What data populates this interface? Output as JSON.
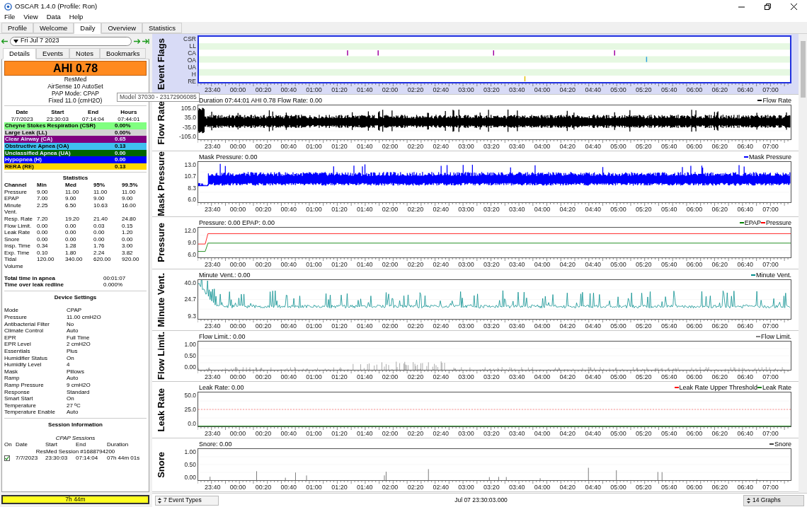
{
  "window": {
    "title": "OSCAR 1.4.0 (Profile: Ron)"
  },
  "menu": [
    "File",
    "View",
    "Data",
    "Help"
  ],
  "tabs": [
    {
      "label": "Profile",
      "selected": false
    },
    {
      "label": "Welcome",
      "selected": false
    },
    {
      "label": "Daily",
      "selected": true
    },
    {
      "label": "Overview",
      "selected": false
    },
    {
      "label": "Statistics",
      "selected": false
    }
  ],
  "date_nav": {
    "date": "Fri Jul 7 2023"
  },
  "detail_tabs": [
    {
      "label": "Details",
      "selected": true
    },
    {
      "label": "Events",
      "selected": false
    },
    {
      "label": "Notes",
      "selected": false
    },
    {
      "label": "Bookmarks",
      "selected": false
    }
  ],
  "summary": {
    "ahi": "AHI 0.78",
    "lines": [
      "ResMed",
      "AirSense 10 AutoSet",
      "PAP Mode: CPAP",
      "Fixed 11.0 (cmH2O)"
    ]
  },
  "tooltip": "Model 37030 - 23172906085",
  "session_table": {
    "columns": [
      "Date",
      "Start",
      "End",
      "Hours"
    ],
    "values": [
      "7/7/2023",
      "23:30:03",
      "07:14:04",
      "07:44:01"
    ]
  },
  "events": [
    {
      "name": "Cheyne Stokes Respiration (CSR)",
      "value": "0.00%",
      "color": "#80ff80"
    },
    {
      "name": "Large Leak (LL)",
      "value": "0.00%",
      "color": "#d3d3d3"
    },
    {
      "name": "Clear Airway (CA)",
      "value": "0.65",
      "color": "#800080"
    },
    {
      "name": "Obstructive Apnea (OA)",
      "value": "0.13",
      "color": "#40c0f0"
    },
    {
      "name": "Unclassified Apnea (UA)",
      "value": "0.00",
      "color": "#006400"
    },
    {
      "name": "Hypopnea (H)",
      "value": "0.00",
      "color": "#0000ff"
    },
    {
      "name": "RERA (RE)",
      "value": "0.13",
      "color": "#ffd700"
    }
  ],
  "statistics": {
    "title": "Statistics",
    "columns": [
      "Channel",
      "Min",
      "Med",
      "95%",
      "99.5%"
    ],
    "rows": [
      [
        "Pressure",
        "9.00",
        "11.00",
        "11.00",
        "11.00"
      ],
      [
        "EPAP",
        "7.00",
        "9.00",
        "9.00",
        "9.00"
      ],
      [
        "Minute Vent.",
        "2.25",
        "6.50",
        "10.63",
        "16.00"
      ],
      [
        "Resp. Rate",
        "7.20",
        "19.20",
        "21.40",
        "24.80"
      ],
      [
        "Flow Limit.",
        "0.00",
        "0.00",
        "0.03",
        "0.15"
      ],
      [
        "Leak Rate",
        "0.00",
        "0.00",
        "0.00",
        "1.20"
      ],
      [
        "Snore",
        "0.00",
        "0.00",
        "0.00",
        "0.00"
      ],
      [
        "Insp. Time",
        "0.34",
        "1.28",
        "1.76",
        "3.00"
      ],
      [
        "Exp. Time",
        "0.10",
        "1.80",
        "2.24",
        "3.82"
      ],
      [
        "Tidal Volume",
        "120.00",
        "340.00",
        "620.00",
        "920.00"
      ]
    ]
  },
  "totals": [
    {
      "label": "Total time in apnea",
      "value": "00:01:07"
    },
    {
      "label": "Time over leak redline",
      "value": "0.000%"
    }
  ],
  "device_settings": {
    "title": "Device Settings",
    "rows": [
      [
        "Mode",
        "CPAP"
      ],
      [
        "Pressure",
        "11.00 cmH2O"
      ],
      [
        "Antibacterial Filter",
        "No"
      ],
      [
        "Climate Control",
        "Auto"
      ],
      [
        "EPR",
        "Full Time"
      ],
      [
        "EPR Level",
        "2 cmH2O"
      ],
      [
        "Essentials",
        "Plus"
      ],
      [
        "Humidifier Status",
        "On"
      ],
      [
        "Humidity Level",
        "4"
      ],
      [
        "Mask",
        "Pillows"
      ],
      [
        "Ramp",
        "Auto"
      ],
      [
        "Ramp Pressure",
        "9 cmH2O"
      ],
      [
        "Response",
        "Standard"
      ],
      [
        "Smart Start",
        "On"
      ],
      [
        "Temperature",
        "27 ºC"
      ],
      [
        "Temperature Enable",
        "Auto"
      ]
    ]
  },
  "session_info": {
    "title": "Session Information",
    "subtitle": "CPAP Sessions",
    "columns": [
      "On",
      "Date",
      "Start",
      "End",
      "Duration"
    ],
    "group": "ResMed Session #1688794200",
    "rows": [
      {
        "checked": true,
        "date": "7/7/2023",
        "start": "23:30:03",
        "end": "07:14:04",
        "duration": "07h 44m 01s"
      }
    ]
  },
  "usage_bar": "7h 44m",
  "graphs": [
    {
      "kind": "flags",
      "title": "Event Flags",
      "rows": [
        "CSR",
        "LL",
        "CA",
        "OA",
        "UA",
        "H",
        "RE"
      ],
      "x_ticks": [
        "23:40",
        "00:00",
        "00:20",
        "00:40",
        "01:00",
        "01:20",
        "01:40",
        "02:00",
        "02:20",
        "02:40",
        "03:00",
        "03:20",
        "03:40",
        "04:00",
        "04:20",
        "04:40",
        "05:00",
        "05:20",
        "05:40",
        "06:00",
        "06:20",
        "06:40",
        "07:00"
      ]
    },
    {
      "kind": "noise",
      "title": "Flow Rate",
      "header": "Duration 07:44:01 AHI 0.78 Flow Rate: 0.00",
      "legend": [
        {
          "label": "Flow Rate",
          "color": "#000000"
        }
      ],
      "y_ticks": [
        "105.0",
        "35.0",
        "-35.0",
        "-105.0"
      ],
      "x_ticks": [
        "23:40",
        "00:00",
        "00:20",
        "00:40",
        "01:00",
        "01:20",
        "01:40",
        "02:00",
        "02:20",
        "02:40",
        "03:00",
        "03:20",
        "03:40",
        "04:00",
        "04:20",
        "04:40",
        "05:00",
        "05:20",
        "05:40",
        "06:00",
        "06:20",
        "06:40",
        "07:00"
      ]
    },
    {
      "kind": "band",
      "title": "Mask Pressure",
      "header": "Mask Pressure: 0.00",
      "legend": [
        {
          "label": "Mask Pressure",
          "color": "#0000ff"
        }
      ],
      "y_ticks": [
        "13.0",
        "10.7",
        "8.3",
        "6.0"
      ],
      "x_ticks": [
        "23:40",
        "00:00",
        "00:20",
        "00:40",
        "01:00",
        "01:20",
        "01:40",
        "02:00",
        "02:20",
        "02:40",
        "03:00",
        "03:20",
        "03:40",
        "04:00",
        "04:20",
        "04:40",
        "05:00",
        "05:20",
        "05:40",
        "06:00",
        "06:20",
        "06:40",
        "07:00"
      ]
    },
    {
      "kind": "steps",
      "title": "Pressure",
      "header": "Pressure: 0.00 EPAP: 0.00",
      "legend": [
        {
          "label": "EPAP",
          "color": "#008000"
        },
        {
          "label": "Pressure",
          "color": "#ff0000"
        }
      ],
      "y_ticks": [
        "12.0",
        "9.0",
        "6.0"
      ],
      "x_ticks": [
        "23:40",
        "00:00",
        "00:20",
        "00:40",
        "01:00",
        "01:20",
        "01:40",
        "02:00",
        "02:20",
        "02:40",
        "03:00",
        "03:20",
        "03:40",
        "04:00",
        "04:20",
        "04:40",
        "05:00",
        "05:20",
        "05:40",
        "06:00",
        "06:20",
        "06:40",
        "07:00"
      ]
    },
    {
      "kind": "spiky",
      "title": "Minute Vent.",
      "header": "Minute Vent.: 0.00",
      "legend": [
        {
          "label": "Minute Vent.",
          "color": "#008b8b"
        }
      ],
      "y_ticks": [
        "40.0",
        "24.7",
        "9.3"
      ],
      "x_ticks": [
        "23:40",
        "00:00",
        "00:20",
        "00:40",
        "01:00",
        "01:20",
        "01:40",
        "02:00",
        "02:20",
        "02:40",
        "03:00",
        "03:20",
        "03:40",
        "04:00",
        "04:20",
        "04:40",
        "05:00",
        "05:20",
        "05:40",
        "06:00",
        "06:20",
        "06:40",
        "07:00"
      ]
    },
    {
      "kind": "sparse",
      "title": "Flow Limit.",
      "header": "Flow Limit.: 0.00",
      "legend": [
        {
          "label": "Flow Limit.",
          "color": "#808080"
        }
      ],
      "y_ticks": [
        "1.00",
        "0.50",
        "0.00"
      ],
      "x_ticks": [
        "23:40",
        "00:00",
        "00:20",
        "00:40",
        "01:00",
        "01:20",
        "01:40",
        "02:00",
        "02:20",
        "02:40",
        "03:00",
        "03:20",
        "03:40",
        "04:00",
        "04:20",
        "04:40",
        "05:00",
        "05:20",
        "05:40",
        "06:00",
        "06:20",
        "06:40",
        "07:00"
      ]
    },
    {
      "kind": "threshold",
      "title": "Leak Rate",
      "header": "Leak Rate: 0.00",
      "legend": [
        {
          "label": "Leak Rate Upper Threshold",
          "color": "#ff0000"
        },
        {
          "label": "Leak Rate",
          "color": "#008000"
        }
      ],
      "y_ticks": [
        "50.0",
        "25.0",
        "0.0"
      ],
      "x_ticks": [
        "23:40",
        "00:00",
        "00:20",
        "00:40",
        "01:00",
        "01:20",
        "01:40",
        "02:00",
        "02:20",
        "02:40",
        "03:00",
        "03:20",
        "03:40",
        "04:00",
        "04:20",
        "04:40",
        "05:00",
        "05:20",
        "05:40",
        "06:00",
        "06:20",
        "06:40",
        "07:00"
      ]
    },
    {
      "kind": "rare",
      "title": "Snore",
      "header": "Snore: 0.00",
      "legend": [
        {
          "label": "Snore",
          "color": "#404040"
        }
      ],
      "y_ticks": [
        "1.00",
        "0.50",
        "0.00"
      ],
      "x_ticks": [
        "23:40",
        "00:00",
        "00:20",
        "00:40",
        "01:00",
        "01:20",
        "01:40",
        "02:00",
        "02:20",
        "02:40",
        "03:00",
        "03:20",
        "03:40",
        "04:00",
        "04:20",
        "04:40",
        "05:00",
        "05:20",
        "05:40",
        "06:00",
        "06:20",
        "06:40",
        "07:00"
      ]
    }
  ],
  "status_bar": {
    "event_types": "7 Event Types",
    "time": "Jul 07 23:30:03.000",
    "graphs": "14 Graphs"
  }
}
